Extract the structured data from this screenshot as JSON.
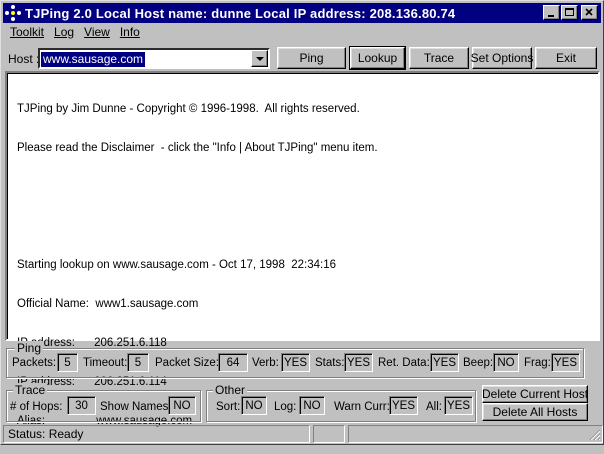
{
  "window": {
    "title": "TJPing 2.0     Local Host name:  dunne     Local IP address: 208.136.80.74"
  },
  "menu": [
    {
      "label": "Toolkit"
    },
    {
      "label": "Log"
    },
    {
      "label": "View"
    },
    {
      "label": "Info"
    }
  ],
  "toolbar": {
    "host_label": "Host :",
    "host_value": "www.sausage.com",
    "ping_label": "Ping",
    "lookup_label": "Lookup",
    "trace_label": "Trace",
    "set_options_label": "Set Options",
    "exit_label": "Exit"
  },
  "output": {
    "lines": [
      "TJPing by Jim Dunne - Copyright © 1996-1998.  All rights reserved.",
      "Please read the Disclaimer  - click the \"Info | About TJPing\" menu item.",
      "",
      "",
      "Starting lookup on www.sausage.com - Oct 17, 1998  22:34:16",
      "Official Name:  www1.sausage.com",
      "IP address:      206.251.6.118",
      "IP address:      206.251.6.114",
      "Alias:                www.sausage.com"
    ]
  },
  "ping": {
    "group_label": "Ping",
    "packets_label": "Packets:",
    "packets_value": "5",
    "timeout_label": "Timeout:",
    "timeout_value": "5",
    "packet_size_label": "Packet Size:",
    "packet_size_value": "64",
    "verb_label": "Verb:",
    "verb_value": "YES",
    "stats_label": "Stats:",
    "stats_value": "YES",
    "ret_data_label": "Ret. Data:",
    "ret_data_value": "YES",
    "beep_label": "Beep:",
    "beep_value": "NO",
    "frag_label": "Frag:",
    "frag_value": "YES"
  },
  "trace": {
    "group_label": "Trace",
    "hops_label": "# of Hops:",
    "hops_value": "30",
    "show_names_label": "Show Names:",
    "show_names_value": "NO"
  },
  "other": {
    "group_label": "Other",
    "sort_label": "Sort:",
    "sort_value": "NO",
    "log_label": "Log:",
    "log_value": "NO",
    "warn_curr_label": "Warn Curr:",
    "warn_curr_value": "YES",
    "all_label": "All:",
    "all_value": "YES"
  },
  "hosts": {
    "delete_current_label": "Delete Current Host",
    "delete_all_label": "Delete All Hosts"
  },
  "status": {
    "text": "Status: Ready"
  },
  "colors": {
    "titlebar": "#000080",
    "face": "#c0c0c0"
  }
}
